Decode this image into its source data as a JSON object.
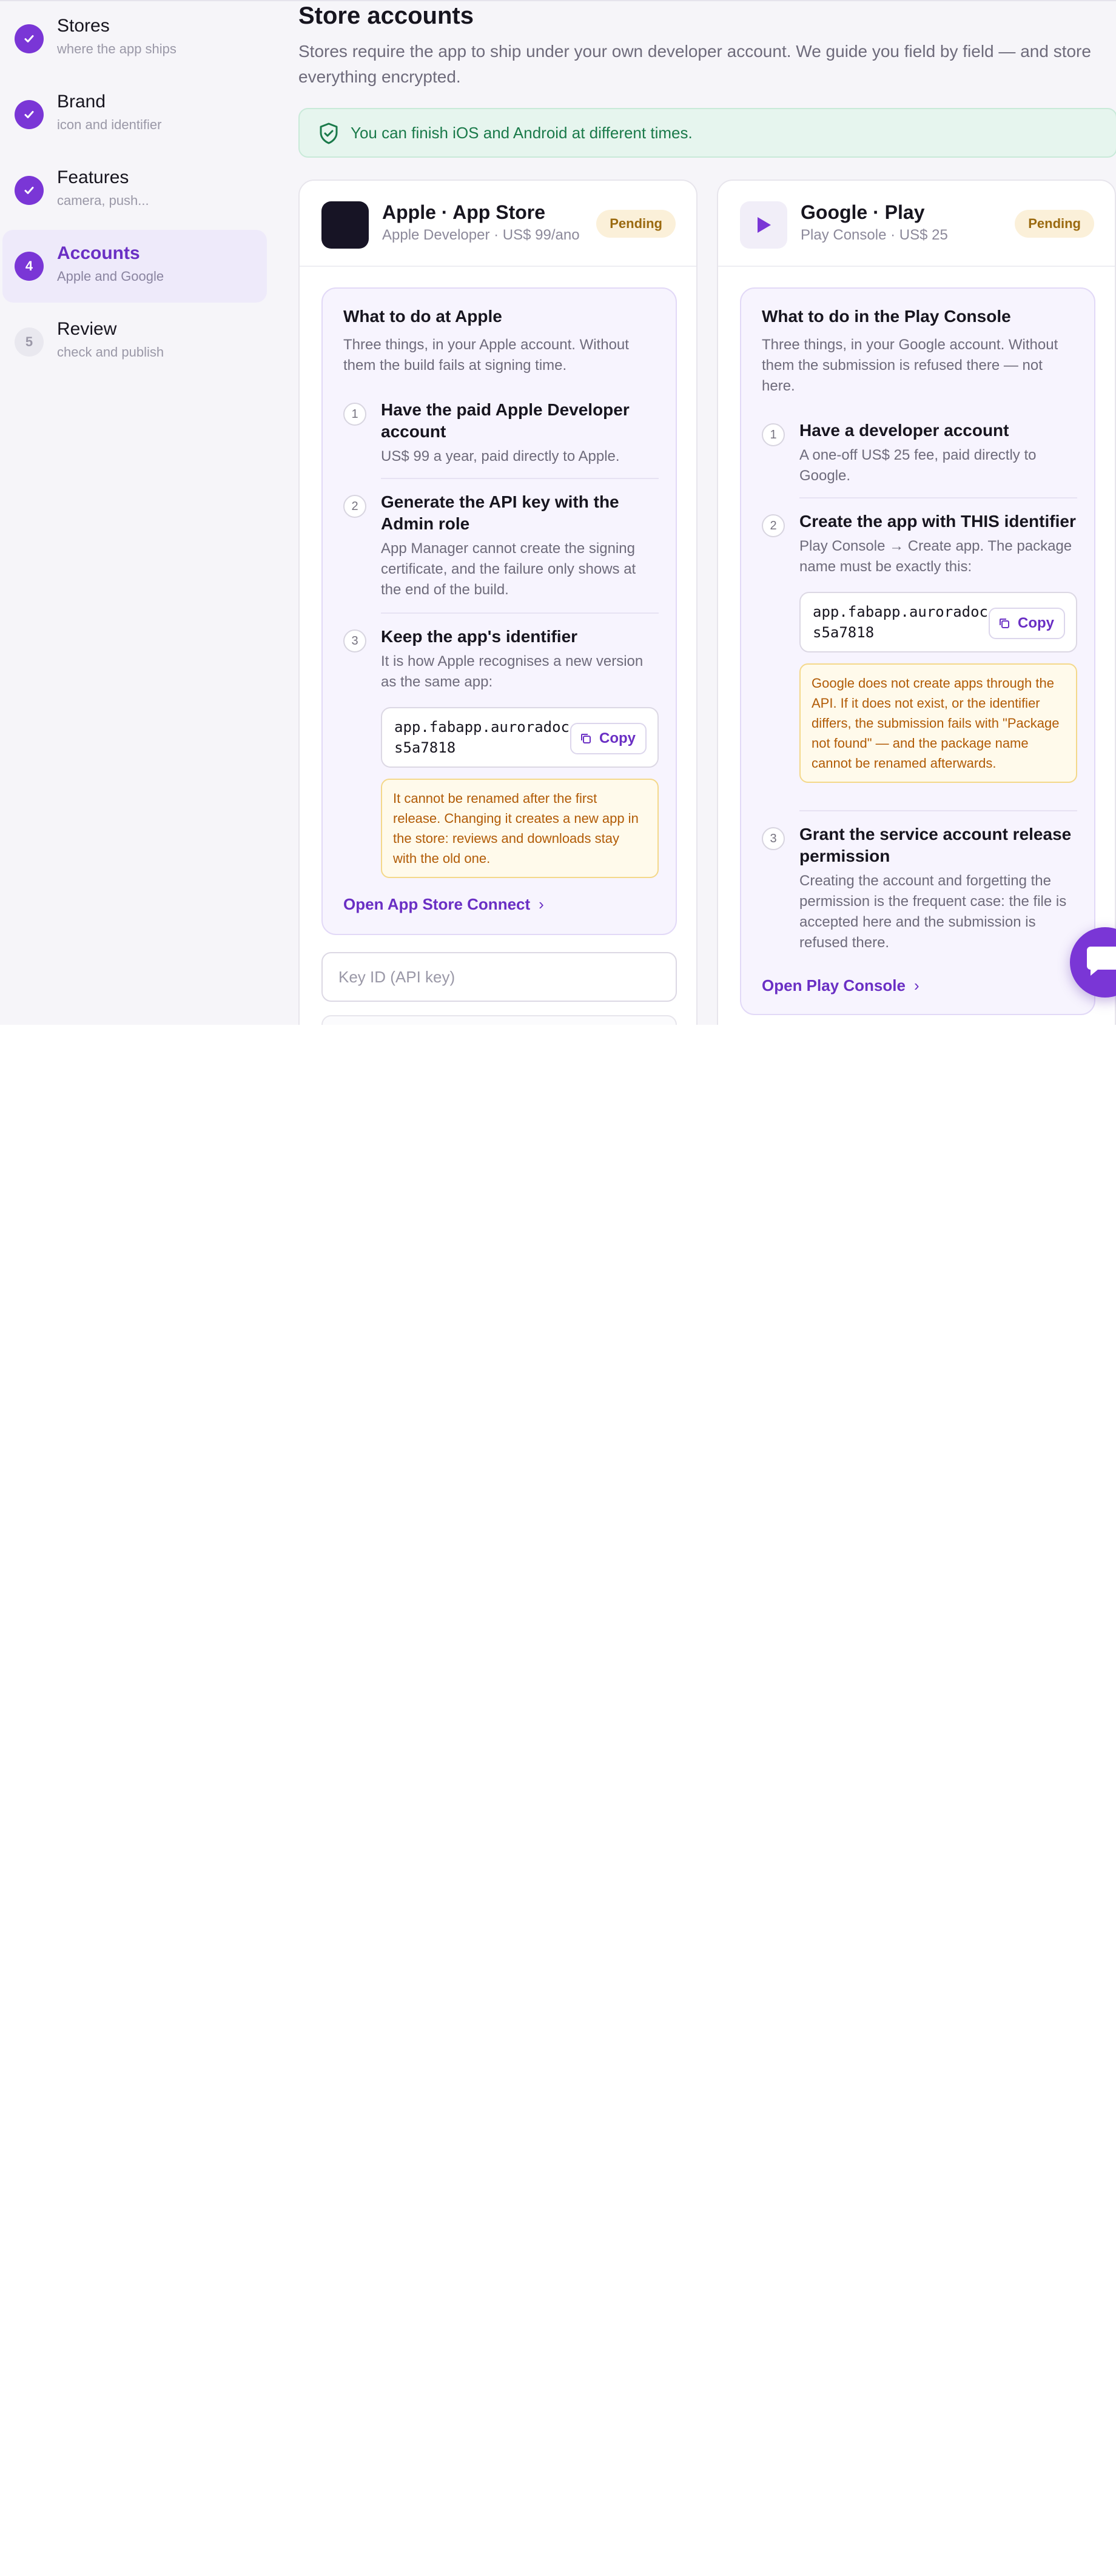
{
  "sidebar": {
    "steps": [
      {
        "number": "1",
        "title": "Stores",
        "subtitle": "where the app ships",
        "status": "done"
      },
      {
        "number": "2",
        "title": "Brand",
        "subtitle": "icon and identifier",
        "status": "done"
      },
      {
        "number": "3",
        "title": "Features",
        "subtitle": "camera, push...",
        "status": "done"
      },
      {
        "number": "4",
        "title": "Accounts",
        "subtitle": "Apple and Google",
        "status": "active"
      },
      {
        "number": "5",
        "title": "Review",
        "subtitle": "check and publish",
        "status": "todo"
      }
    ]
  },
  "main": {
    "title": "Store accounts",
    "description": "Stores require the app to ship under your own developer account. We guide you field by field — and store everything encrypted.",
    "notice": "You can finish iOS and Android at different times."
  },
  "apple": {
    "title": "Apple · App Store",
    "subtitle": "Apple Developer · US$ 99/ano",
    "badge": "Pending",
    "guide_title": "What to do at Apple",
    "guide_desc": "Three things, in your Apple account. Without them the build fails at signing time.",
    "items": [
      {
        "num": "1",
        "title": "Have the paid Apple Developer account",
        "text": "US$ 99 a year, paid directly to Apple."
      },
      {
        "num": "2",
        "title": "Generate the API key with the Admin role",
        "text": "App Manager cannot create the signing certificate, and the failure only shows at the end of the build."
      },
      {
        "num": "3",
        "title": "Keep the app's identifier",
        "text": "It is how Apple recognises a new version as the same app:"
      }
    ],
    "identifier": "app.fabapp.auroradocs5a7818",
    "copy_label": "Copy",
    "warning": "It cannot be renamed after the first release. Changing it creates a new app in the store: reviews and downloads stay with the old one.",
    "link": "Open App Store Connect",
    "key_placeholder": "Key ID (API key)"
  },
  "google": {
    "title": "Google · Play",
    "subtitle": "Play Console · US$ 25",
    "badge": "Pending",
    "guide_title": "What to do in the Play Console",
    "guide_desc": "Three things, in your Google account. Without them the submission is refused there — not here.",
    "items": [
      {
        "num": "1",
        "title": "Have a developer account",
        "text": "A one-off US$ 25 fee, paid directly to Google."
      },
      {
        "num": "2",
        "title": "Create the app with THIS identifier",
        "text": "Play Console → Create app. The package name must be exactly this:"
      },
      {
        "num": "3",
        "title": "Grant the service account release permission",
        "text": "Creating the account and forgetting the permission is the frequent case: the file is accepted here and the submission is refused there."
      }
    ],
    "identifier": "app.fabapp.auroradocs5a7818",
    "copy_label": "Copy",
    "warning": "Google does not create apps through the API. If it does not exist, or the identifier differs, the submission fails with \"Package not found\" — and the package name cannot be renamed afterwards.",
    "link": "Open Play Console"
  },
  "colors": {
    "accent": "#7a36d6",
    "success": "#1a7a4a",
    "warning": "#b15b06",
    "badge_bg": "#fbf0d9"
  },
  "icons": {
    "step_done": "check-icon",
    "notice": "shield-check-icon",
    "copy": "copy-icon",
    "link": "chevron-right-icon",
    "google_logo": "play-triangle-icon",
    "chat": "chat-bubble-icon"
  }
}
